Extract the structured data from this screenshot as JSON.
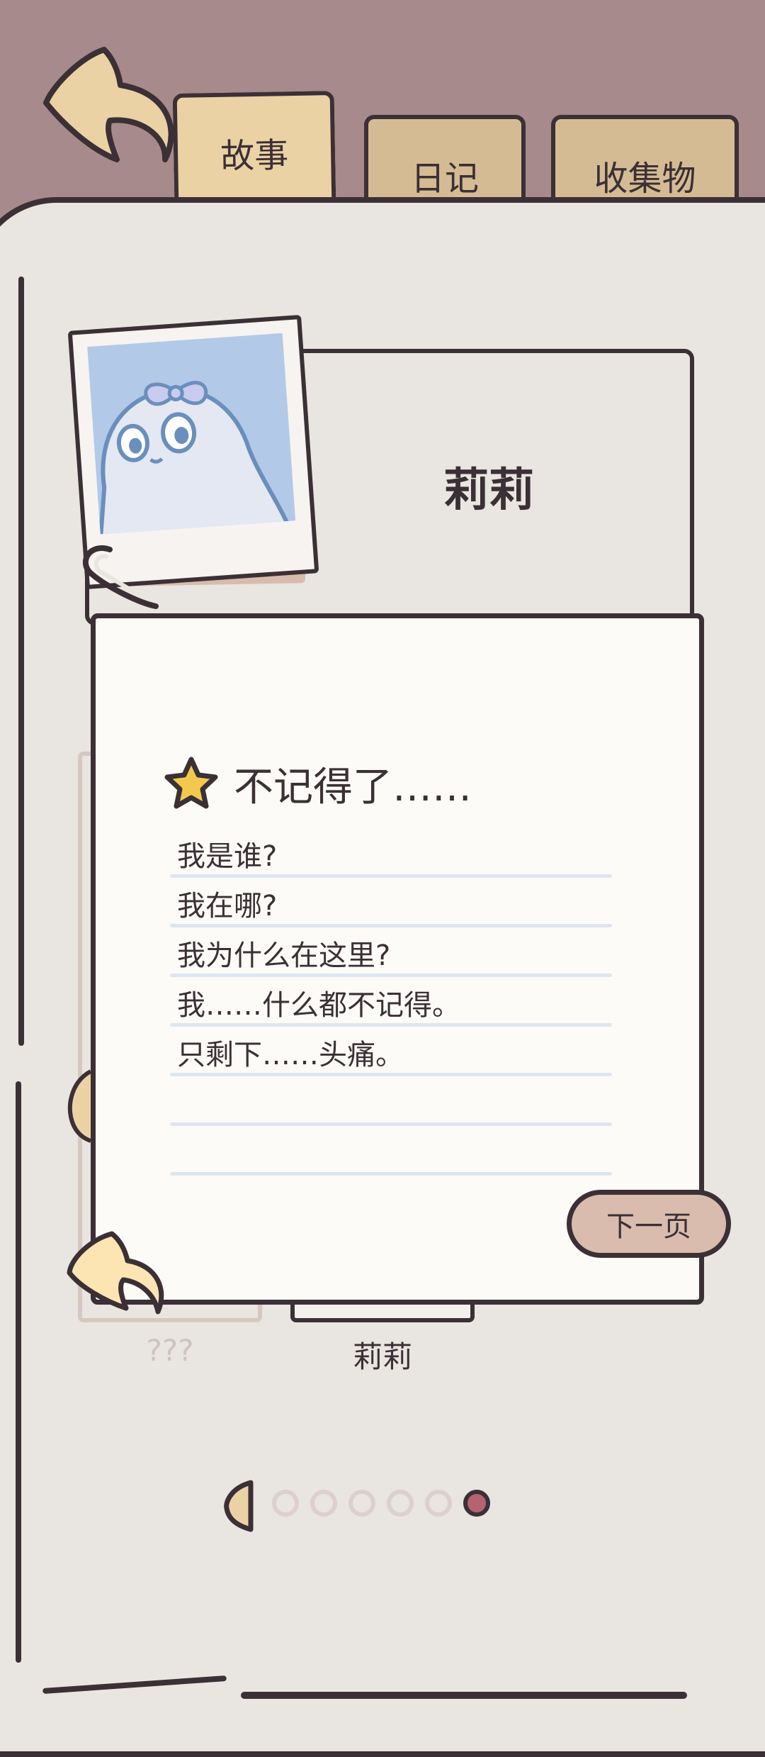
{
  "tabs": [
    {
      "label": "故事",
      "active": true
    },
    {
      "label": "日记",
      "active": false
    },
    {
      "label": "收集物",
      "active": false
    }
  ],
  "profile": {
    "name": "莉莉"
  },
  "note": {
    "title": "不记得了……",
    "lines": [
      "我是谁?",
      "我在哪?",
      "我为什么在这里?",
      "我……什么都不记得。",
      "只剩下……头痛。"
    ],
    "next_label": "下一页"
  },
  "cards": {
    "unknown_label": "???",
    "selected_label": "莉莉"
  },
  "pagination": {
    "total": 6,
    "current": 6
  },
  "colors": {
    "background": "#a68a8c",
    "page": "#e9e5e1",
    "outline": "#3b3035",
    "tab_active": "#ebd2a4",
    "tab_inactive": "#d4bb93",
    "button": "#d9bcae",
    "active_dot": "#b36470"
  }
}
